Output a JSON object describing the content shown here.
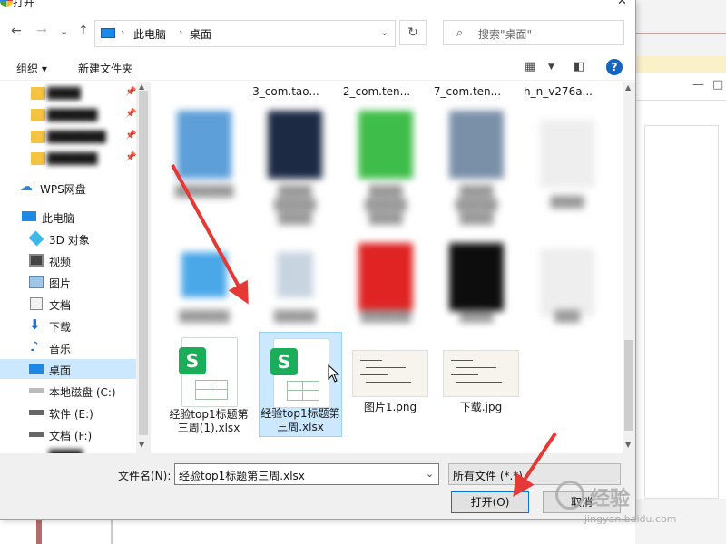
{
  "dialog": {
    "title": "打开",
    "close_glyph": "✕"
  },
  "nav": {
    "back": "←",
    "forward": "→",
    "dropdown": "⌄",
    "up": "↑",
    "breadcrumb": [
      "此电脑",
      "桌面"
    ],
    "refresh": "↻",
    "search_placeholder": "搜索\"桌面\""
  },
  "toolbar": {
    "organize": "组织 ▾",
    "new_folder": "新建文件夹",
    "help": "?"
  },
  "sidebar": {
    "items": [
      {
        "label": "WPS网盘",
        "icon": "cloud-icon"
      },
      {
        "label": "此电脑",
        "icon": "computer-icon"
      },
      {
        "label": "3D 对象",
        "icon": "cube-icon"
      },
      {
        "label": "视频",
        "icon": "video-icon"
      },
      {
        "label": "图片",
        "icon": "picture-icon"
      },
      {
        "label": "文档",
        "icon": "document-icon"
      },
      {
        "label": "下载",
        "icon": "download-icon"
      },
      {
        "label": "音乐",
        "icon": "music-icon"
      },
      {
        "label": "桌面",
        "icon": "desktop-icon"
      },
      {
        "label": "本地磁盘 (C:)",
        "icon": "drive-icon"
      },
      {
        "label": "软件 (E:)",
        "icon": "drive-icon"
      },
      {
        "label": "文档 (F:)",
        "icon": "drive-icon"
      }
    ]
  },
  "files": {
    "top_row": [
      "3_com.tao...",
      "2_com.ten...",
      "7_com.ten...",
      "h_n_v276a..."
    ],
    "file1": {
      "name": "经验top1标题第三周(1).xlsx"
    },
    "file2": {
      "name": "经验top1标题第三周.xlsx"
    },
    "file3": {
      "name": "图片1.png"
    },
    "file4": {
      "name": "下载.jpg"
    }
  },
  "bottom": {
    "filename_label": "文件名(N):",
    "filename_value": "经验top1标题第三周.xlsx",
    "filetype_value": "所有文件 (*.*)",
    "open_button": "打开(O)",
    "cancel_button": "取消"
  },
  "watermark": {
    "brand": "经验",
    "url": "jingyan.baidu.com"
  },
  "colors": {
    "accent": "#0078d7",
    "selection": "#cce8ff",
    "arrow": "#e53935",
    "wps_green": "#1aad5a"
  }
}
